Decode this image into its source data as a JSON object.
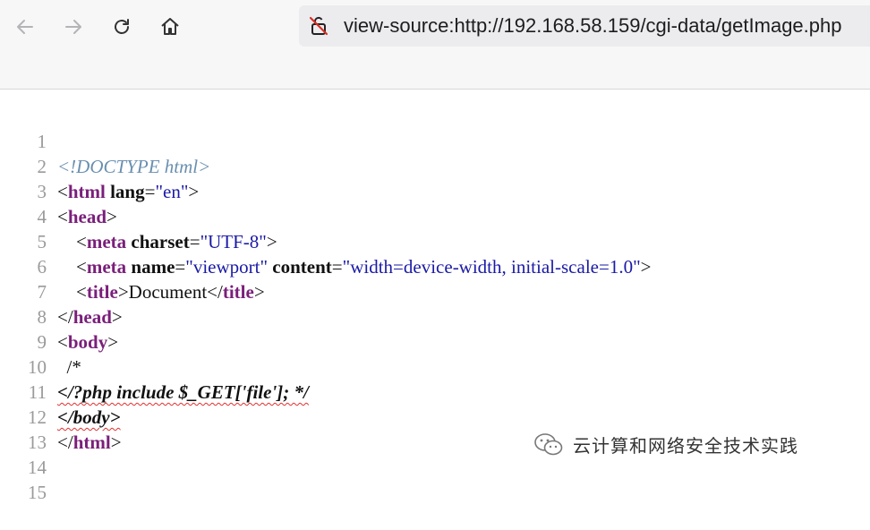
{
  "browser": {
    "back_icon": "arrow-left-icon",
    "forward_icon": "arrow-right-icon",
    "reload_icon": "reload-icon",
    "home_icon": "home-icon",
    "security_icon": "not-secure-lock-icon",
    "url": "view-source:http://192.168.58.159/cgi-data/getImage.php"
  },
  "source": {
    "line_numbers": [
      "1",
      "2",
      "3",
      "4",
      "5",
      "6",
      "7",
      "8",
      "9",
      "10",
      "11",
      "12",
      "13",
      "14",
      "15"
    ],
    "l1": {
      "doctype": "<!DOCTYPE html>"
    },
    "l2": {
      "open": "<",
      "name": "html",
      "attr": "lang",
      "eq": "=",
      "val": "\"en\"",
      "close": ">"
    },
    "l3": {
      "open": "<",
      "name": "head",
      "close": ">"
    },
    "l4": {
      "indent": "    ",
      "open": "<",
      "name": "meta",
      "attr": "charset",
      "eq": "=",
      "val": "\"UTF-8\"",
      "close": ">"
    },
    "l5": {
      "indent": "    ",
      "open": "<",
      "name": "meta",
      "attr1": "name",
      "eq1": "=",
      "val1": "\"viewport\"",
      "attr2": "content",
      "eq2": "=",
      "val2": "\"width=device-width, initial-scale=1.0\"",
      "close": ">"
    },
    "l6": {
      "indent": "    ",
      "open": "<",
      "name": "title",
      "close": ">",
      "text": "Document",
      "open2": "</",
      "name2": "title",
      "close2": ">"
    },
    "l7": {
      "open": "</",
      "name": "head",
      "close": ">"
    },
    "l8": {
      "open": "<",
      "name": "body",
      "close": ">"
    },
    "l9": {
      "text": "  /*"
    },
    "l10": {
      "text": "</?php include $_GET['file']; */"
    },
    "l11": {
      "text": "</body>"
    },
    "l12": {
      "open": "</",
      "name": "html",
      "close": ">"
    }
  },
  "watermark": {
    "icon": "wechat-icon",
    "text": "云计算和网络安全技术实践"
  }
}
